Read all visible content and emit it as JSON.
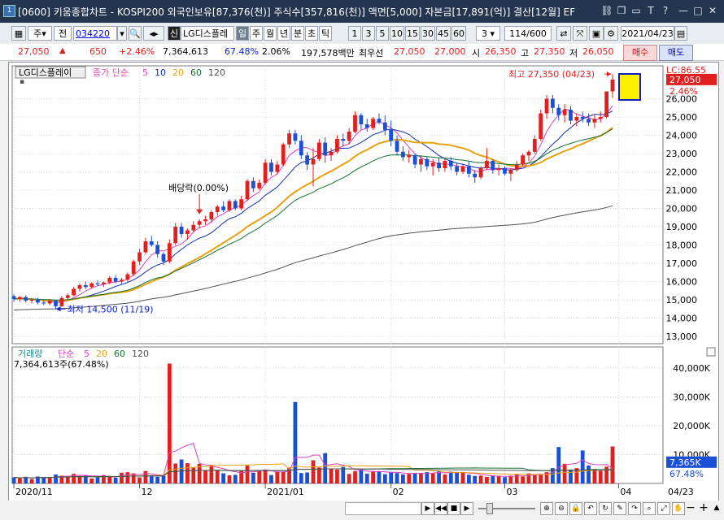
{
  "window": {
    "app_icon": "1",
    "title": "[0600] 키움종합차트 - KOSPI200 외국인보유[87,376(천)] 주식수[357,816(천)] 액면[5,000] 자본금[17,891(억)] 결산[12월] EF"
  },
  "toolbar": {
    "type": "주",
    "scope": "전",
    "code": "034220",
    "badge": "신",
    "name": "LG디스플레",
    "periods": [
      "일",
      "주",
      "월",
      "년",
      "분",
      "초",
      "틱"
    ],
    "active_period": "일",
    "intervals": [
      "1",
      "3",
      "5",
      "10",
      "15",
      "30",
      "45",
      "60"
    ],
    "custom_interval": "3",
    "count": "114/600",
    "date": "2021/04/23"
  },
  "quote": {
    "price": "27,050",
    "change": "650",
    "change_pct": "+2.46%",
    "volume": "7,364,613",
    "vol_ratio": "67.48%",
    "ratio2": "2.06%",
    "amount": "197,578백만",
    "bid_label": "최우선",
    "bid1": "27,050",
    "bid2": "27,000",
    "open_label": "시",
    "open": "26,350",
    "high_label": "고",
    "high": "27,350",
    "low_label": "저",
    "low": "26,050",
    "buy_label": "매수",
    "sell_label": "매도"
  },
  "price_panel": {
    "name_tag": "LG디스플레이",
    "legend_prefix": "종가 단순",
    "ma_labels": [
      "5",
      "10",
      "20",
      "60",
      "120"
    ],
    "ma_colors": [
      "#e040c0",
      "#1030b0",
      "#e8a010",
      "#107030",
      "#505050"
    ],
    "lc_label": "LC:86.55",
    "last_price_tag": "27,050",
    "last_change_tag": "2.46%",
    "high_annotation": "최고 27,350 (04/23)",
    "low_annotation": "최저 14,500 (11/19)",
    "dividend_annotation": "배당락(0.00%)",
    "y_ticks": [
      "26,000",
      "25,000",
      "24,000",
      "23,000",
      "22,000",
      "21,000",
      "20,000",
      "19,000",
      "18,000",
      "17,000",
      "16,000",
      "15,000",
      "14,000",
      "13,000"
    ]
  },
  "volume_panel": {
    "title_prefix": "거래량",
    "legend_prefix": "단순",
    "ma_labels": [
      "5",
      "20",
      "60",
      "120"
    ],
    "ma_colors": [
      "#e040c0",
      "#e8a010",
      "#107030",
      "#505050"
    ],
    "subtitle": "7,364,613주(67.48%)",
    "y_ticks": [
      "40,000K",
      "30,000K",
      "20,000K",
      "10,000K"
    ],
    "last_tag": "7,365K",
    "last_pct": "67.48%"
  },
  "x_axis": {
    "labels": [
      "2020/11",
      "12",
      "2021/01",
      "02",
      "03",
      "04"
    ],
    "end_label": "04/23"
  },
  "chart_data": {
    "type": "candlestick",
    "period": "daily",
    "ylim": [
      12600,
      27800
    ],
    "volume_ylim": [
      0,
      45000
    ],
    "candles": [
      [
        15200,
        15300,
        14900,
        15050
      ],
      [
        15050,
        15200,
        14900,
        15150
      ],
      [
        15150,
        15250,
        14850,
        14950
      ],
      [
        14950,
        15100,
        14800,
        15000
      ],
      [
        15000,
        15100,
        14750,
        14850
      ],
      [
        14850,
        15000,
        14700,
        14800
      ],
      [
        14800,
        15050,
        14700,
        14950
      ],
      [
        14950,
        15000,
        14500,
        14650
      ],
      [
        14650,
        15200,
        14600,
        15100
      ],
      [
        15100,
        15350,
        15000,
        15250
      ],
      [
        15250,
        15700,
        15200,
        15600
      ],
      [
        15600,
        15900,
        15450,
        15800
      ],
      [
        15800,
        16000,
        15600,
        15700
      ],
      [
        15700,
        15950,
        15600,
        15900
      ],
      [
        15900,
        16050,
        15750,
        15850
      ],
      [
        15850,
        16000,
        15700,
        15950
      ],
      [
        15950,
        16300,
        15850,
        16200
      ],
      [
        16200,
        16350,
        15900,
        16000
      ],
      [
        16000,
        16200,
        15850,
        16100
      ],
      [
        16100,
        16500,
        16000,
        16400
      ],
      [
        16400,
        17200,
        16300,
        17100
      ],
      [
        17100,
        17800,
        16900,
        17600
      ],
      [
        17600,
        18400,
        17500,
        18200
      ],
      [
        18200,
        18500,
        17900,
        18000
      ],
      [
        18000,
        18200,
        17300,
        17500
      ],
      [
        17500,
        17600,
        16900,
        17100
      ],
      [
        17100,
        18300,
        17000,
        18100
      ],
      [
        18100,
        19200,
        18000,
        19000
      ],
      [
        19000,
        19200,
        18400,
        18600
      ],
      [
        18600,
        18900,
        18300,
        18800
      ],
      [
        18800,
        19300,
        18700,
        19100
      ],
      [
        19100,
        19400,
        18900,
        19300
      ],
      [
        19300,
        19600,
        19100,
        19400
      ],
      [
        19400,
        19900,
        19200,
        19800
      ],
      [
        19800,
        20200,
        19600,
        20100
      ],
      [
        20100,
        20400,
        19800,
        19900
      ],
      [
        19900,
        20500,
        19800,
        20400
      ],
      [
        20400,
        20500,
        19900,
        20000
      ],
      [
        20000,
        20700,
        19900,
        20500
      ],
      [
        20500,
        21600,
        20400,
        21500
      ],
      [
        21500,
        21700,
        20900,
        21100
      ],
      [
        21100,
        21600,
        21000,
        21400
      ],
      [
        21400,
        22700,
        21300,
        22500
      ],
      [
        22500,
        22700,
        21800,
        22000
      ],
      [
        22000,
        22600,
        21900,
        22400
      ],
      [
        22400,
        23600,
        22300,
        23500
      ],
      [
        23500,
        24300,
        23300,
        24100
      ],
      [
        24100,
        24300,
        23500,
        23700
      ],
      [
        23700,
        24000,
        22700,
        22900
      ],
      [
        22900,
        23100,
        22100,
        22400
      ],
      [
        22400,
        23300,
        21200,
        22700
      ],
      [
        22700,
        23800,
        22600,
        23600
      ],
      [
        23600,
        23900,
        22500,
        22900
      ],
      [
        22900,
        23300,
        22600,
        23100
      ],
      [
        23100,
        24000,
        23000,
        23800
      ],
      [
        23800,
        24100,
        23400,
        23700
      ],
      [
        23700,
        24400,
        23500,
        24200
      ],
      [
        24200,
        25300,
        24100,
        25100
      ],
      [
        25100,
        25200,
        24300,
        24600
      ],
      [
        24600,
        24900,
        24200,
        24400
      ],
      [
        24400,
        25000,
        24300,
        24900
      ],
      [
        24900,
        25200,
        24600,
        24700
      ],
      [
        24700,
        25100,
        24000,
        24300
      ],
      [
        24300,
        24800,
        23400,
        23700
      ],
      [
        23700,
        24000,
        22900,
        23100
      ],
      [
        23100,
        23400,
        22600,
        22800
      ],
      [
        22800,
        23200,
        22500,
        22900
      ],
      [
        22900,
        23000,
        22200,
        22400
      ],
      [
        22400,
        22900,
        22000,
        22700
      ],
      [
        22700,
        22800,
        22100,
        22300
      ],
      [
        22300,
        22700,
        21800,
        22500
      ],
      [
        22500,
        22800,
        22000,
        22200
      ],
      [
        22200,
        22700,
        22000,
        22600
      ],
      [
        22600,
        22800,
        22100,
        22300
      ],
      [
        22300,
        22500,
        21800,
        22000
      ],
      [
        22000,
        22400,
        21900,
        22300
      ],
      [
        22300,
        22600,
        21700,
        21900
      ],
      [
        21900,
        22100,
        21400,
        21700
      ],
      [
        21700,
        22300,
        21600,
        22200
      ],
      [
        22200,
        23300,
        22100,
        22600
      ],
      [
        22600,
        22700,
        21900,
        22100
      ],
      [
        22100,
        22400,
        21800,
        22200
      ],
      [
        22200,
        22300,
        21800,
        21900
      ],
      [
        21900,
        22200,
        21500,
        22100
      ],
      [
        22100,
        22600,
        22000,
        22400
      ],
      [
        22400,
        23000,
        22300,
        22900
      ],
      [
        22900,
        23200,
        22600,
        23100
      ],
      [
        23100,
        24000,
        23000,
        23800
      ],
      [
        23800,
        25400,
        23700,
        25200
      ],
      [
        25200,
        26200,
        24900,
        26000
      ],
      [
        26000,
        26200,
        25200,
        25500
      ],
      [
        25500,
        25700,
        24800,
        25100
      ],
      [
        25100,
        25700,
        24700,
        25400
      ],
      [
        25400,
        25600,
        24600,
        24800
      ],
      [
        24800,
        25200,
        24500,
        25000
      ],
      [
        25000,
        25300,
        24700,
        24900
      ],
      [
        24900,
        25200,
        24500,
        24700
      ],
      [
        24700,
        25100,
        24400,
        24900
      ],
      [
        24900,
        25300,
        24700,
        25000
      ],
      [
        25000,
        26200,
        24900,
        26400
      ],
      [
        26400,
        27350,
        26050,
        27050
      ]
    ],
    "volume": [
      2100,
      1800,
      2300,
      1500,
      2400,
      2200,
      1900,
      3100,
      2700,
      2400,
      3300,
      2600,
      2900,
      1700,
      2200,
      2900,
      2600,
      2000,
      3700,
      3900,
      3500,
      2100,
      4300,
      2700,
      2300,
      2600,
      41500,
      6900,
      8300,
      7000,
      5500,
      6800,
      4600,
      6400,
      4600,
      3500,
      2800,
      3000,
      4400,
      6200,
      3700,
      4400,
      4800,
      2900,
      4000,
      4000,
      5500,
      28200,
      3600,
      3800,
      8000,
      5500,
      10500,
      5100,
      4800,
      5700,
      3300,
      4200,
      4800,
      3400,
      4300,
      4200,
      3200,
      4000,
      3600,
      3100,
      3300,
      3600,
      3600,
      3900,
      3500,
      4200,
      3100,
      4100,
      3900,
      3900,
      3000,
      2600,
      2700,
      2300,
      2600,
      2500,
      2200,
      2700,
      3100,
      2400,
      3500,
      2900,
      3300,
      3900,
      5300,
      12600,
      6800,
      4800,
      5300,
      11400,
      6200,
      5000,
      4400,
      5800,
      4500,
      4700,
      5300,
      3600,
      12800,
      8300,
      7365
    ]
  }
}
